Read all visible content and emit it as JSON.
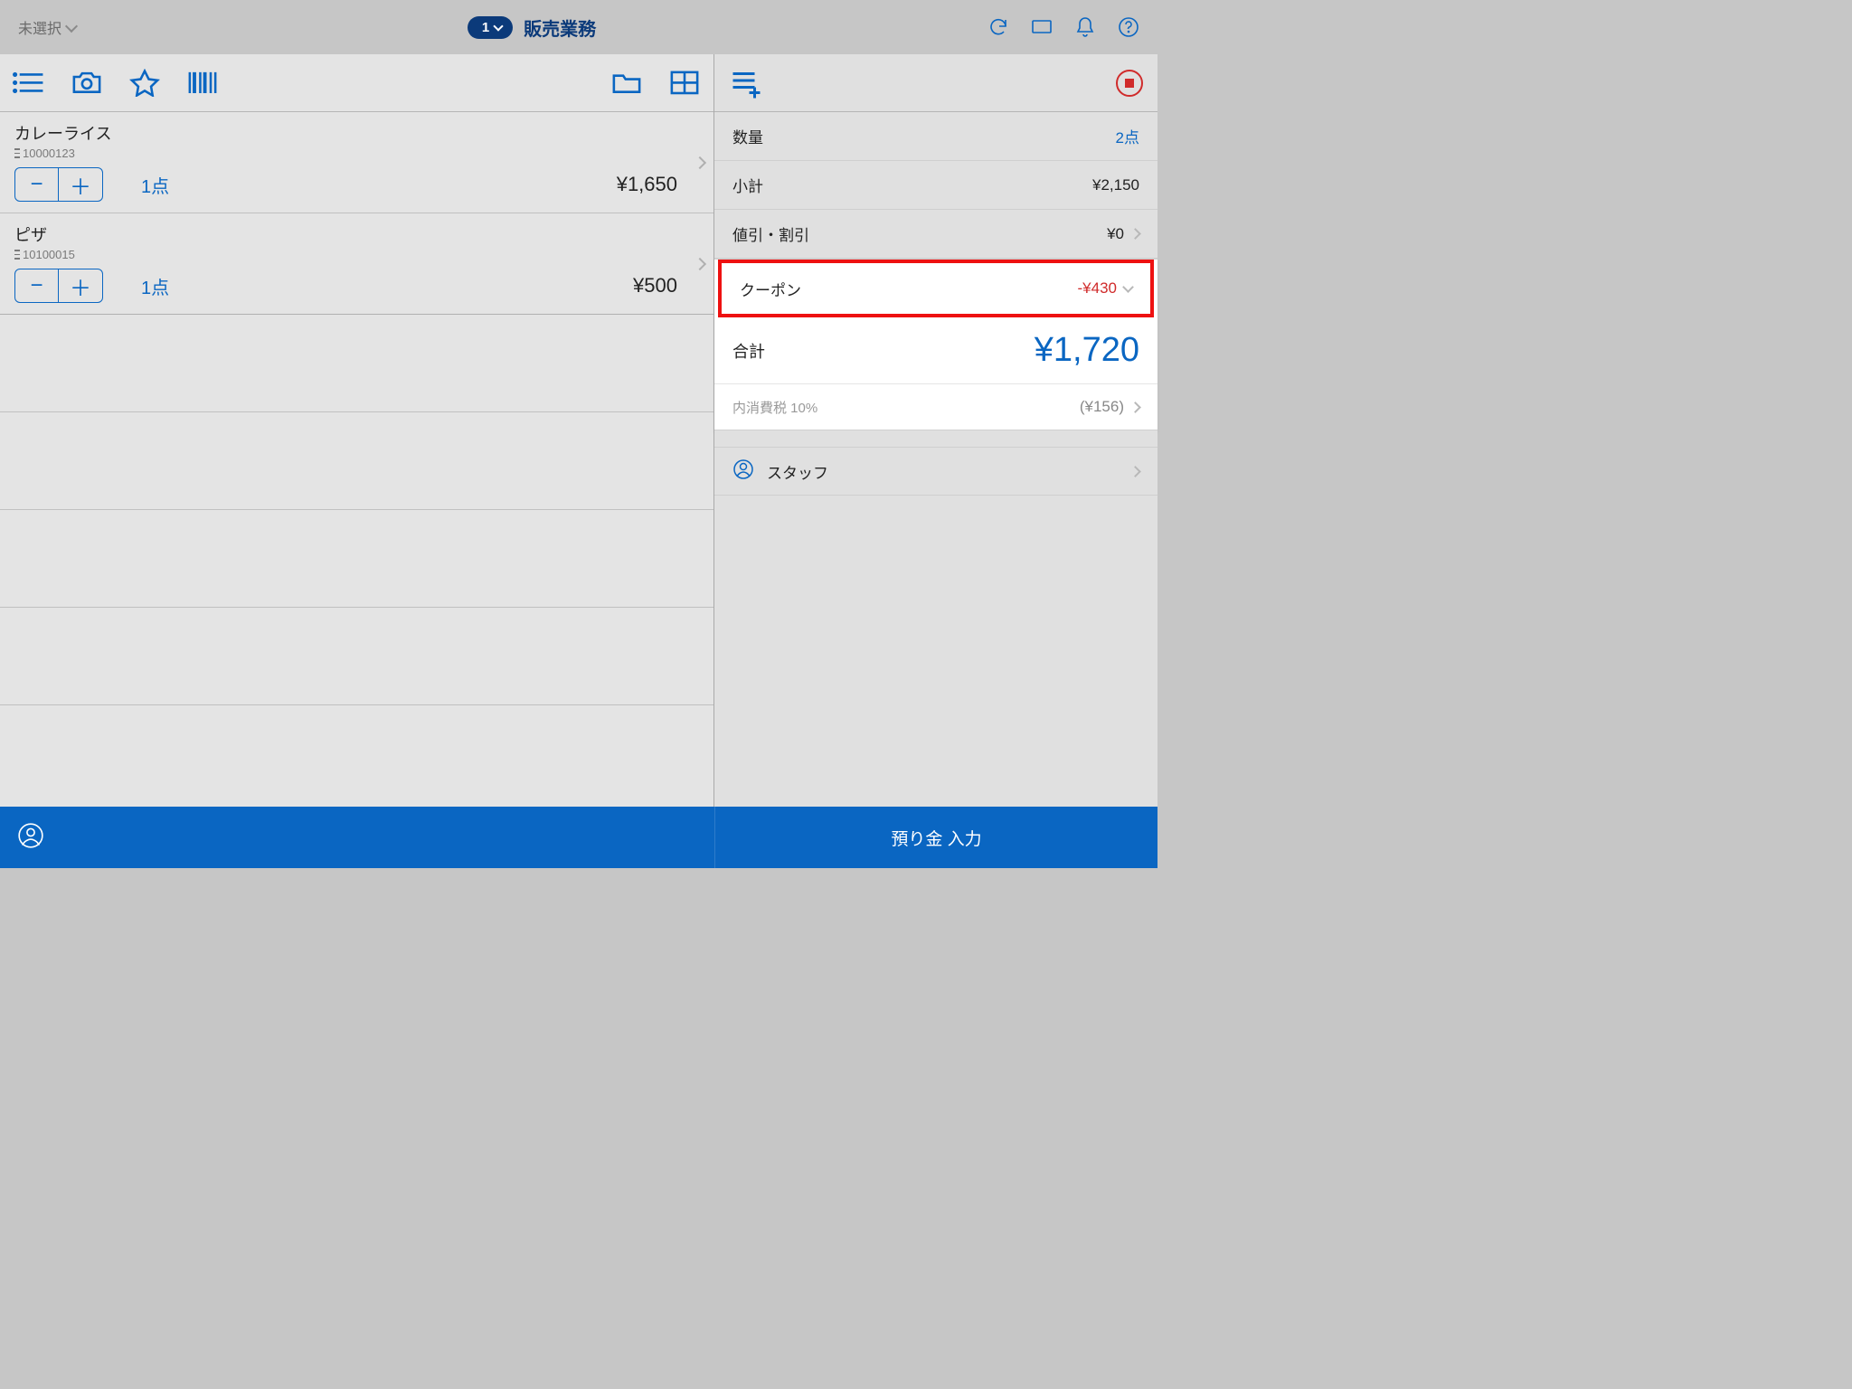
{
  "topbar": {
    "left_label": "未選択",
    "pill_count": "1",
    "title": "販売業務"
  },
  "items": [
    {
      "name": "カレーライス",
      "code": "10000123",
      "qty": "1点",
      "price": "¥1,650"
    },
    {
      "name": "ピザ",
      "code": "10100015",
      "qty": "1点",
      "price": "¥500"
    }
  ],
  "summary": {
    "qty_label": "数量",
    "qty_val": "2点",
    "subtotal_label": "小計",
    "subtotal_val": "¥2,150",
    "discount_label": "値引・割引",
    "discount_val": "¥0",
    "coupon_label": "クーポン",
    "coupon_val": "-¥430",
    "total_label": "合計",
    "total_val": "¥1,720",
    "tax_label": "内消費税 10%",
    "tax_val": "(¥156)",
    "staff_label": "スタッフ"
  },
  "bottom": {
    "pay_label": "預り金 入力"
  }
}
